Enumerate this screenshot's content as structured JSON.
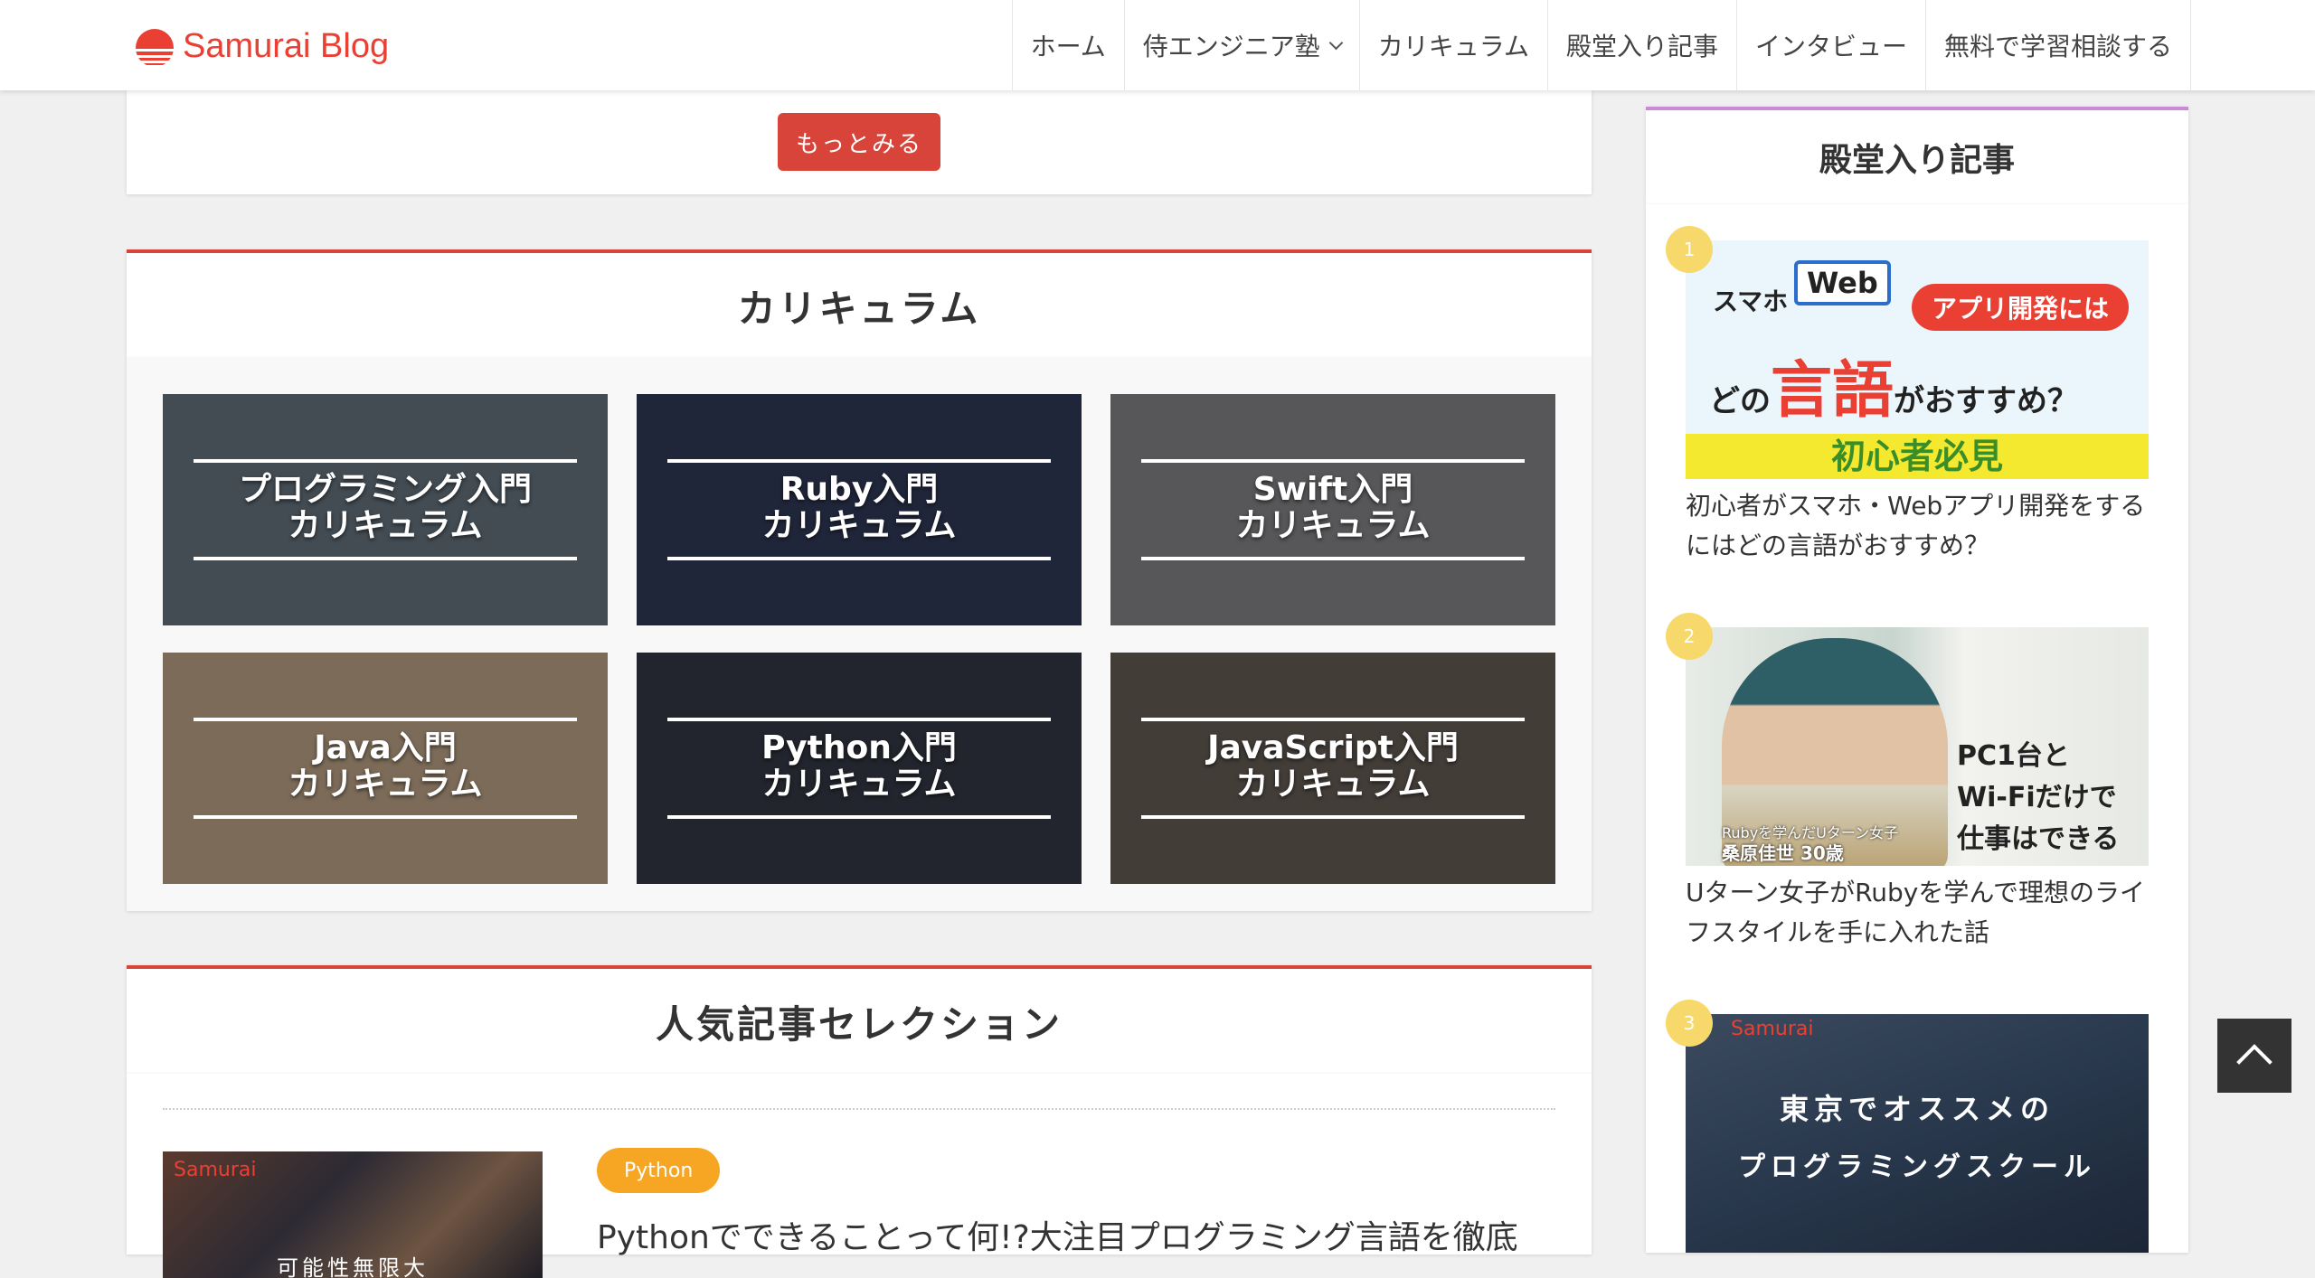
{
  "site": {
    "logo_text": "Samurai Blog",
    "accent": "#e94033"
  },
  "nav": [
    {
      "label": "ホーム"
    },
    {
      "label": "侍エンジニア塾",
      "dropdown": true
    },
    {
      "label": "カリキュラム"
    },
    {
      "label": "殿堂入り記事"
    },
    {
      "label": "インタビュー"
    },
    {
      "label": "無料で学習相談する"
    }
  ],
  "more_button": "もっとみる",
  "curriculum": {
    "heading": "カリキュラム",
    "tiles": [
      {
        "line1": "プログラミング入門",
        "line2": "カリキュラム",
        "bg": "#5d6a70"
      },
      {
        "line1": "Ruby入門",
        "line2": "カリキュラム",
        "bg": "#27314a"
      },
      {
        "line1": "Swift入門",
        "line2": "カリキュラム",
        "bg": "#7c7a78"
      },
      {
        "line1": "Java入門",
        "line2": "カリキュラム",
        "bg": "#b49a78"
      },
      {
        "line1": "Python入門",
        "line2": "カリキュラム",
        "bg": "#2a2f36"
      },
      {
        "line1": "JavaScript入門",
        "line2": "カリキュラム",
        "bg": "#5d5448"
      }
    ]
  },
  "popular": {
    "heading": "人気記事セレクション",
    "thumb_brand": "Samurai",
    "thumb_caption": "可能性無限大",
    "tag": "Python",
    "title": "Pythonでできることって何!?大注目プログラミング言語を徹底"
  },
  "sidebar": {
    "heading": "殿堂入り記事",
    "items": [
      {
        "rank": "1",
        "title": "初心者がスマホ・Webアプリ開発をするにはどの言語がおすすめ？",
        "img": {
          "sm": "スマホ",
          "web": "Web",
          "pill": "アプリ開発には",
          "pre": "どの",
          "red": "言語",
          "post": "がおすすめ？",
          "band": "初心者必見"
        }
      },
      {
        "rank": "2",
        "title": "Uターン女子がRubyを学んで理想のライフスタイルを手に入れた話",
        "img": {
          "lbl1": "Rubyを学んだUターン女子",
          "lbl2": "桑原佳世 30歳",
          "q1": "PC1台と",
          "q2": "Wi-Fiだけで",
          "q3": "仕事はできる"
        }
      },
      {
        "rank": "3",
        "title": "",
        "img": {
          "brand": "Samurai",
          "line1": "東京でオススメの",
          "line2": "プログラミングスクール"
        }
      }
    ]
  }
}
